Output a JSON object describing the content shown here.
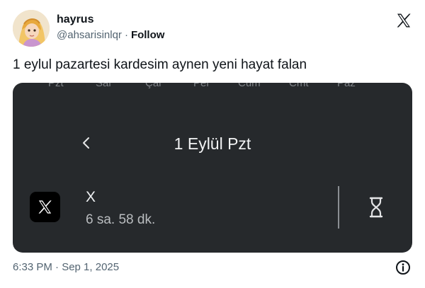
{
  "user": {
    "display_name": "hayrus",
    "handle": "@ahsarisinlqr",
    "separator": "·",
    "follow_label": "Follow"
  },
  "tweet": {
    "text": "1 eylul pazartesi kardesim aynen yeni hayat falan",
    "timestamp": "6:33 PM · Sep 1, 2025"
  },
  "media": {
    "weekdays": [
      "Pzt",
      "Sal",
      "Çar",
      "Per",
      "Cum",
      "Cmt",
      "Paz"
    ],
    "date_title": "1 Eylül Pzt",
    "app_name": "X",
    "usage_time": "6 sa. 58 dk."
  },
  "icons": {
    "brand": "x-logo-icon",
    "back": "chevron-left-icon",
    "timer": "hourglass-icon",
    "info": "info-icon"
  },
  "colors": {
    "card_background": "#26292c",
    "text_primary": "#0f1419",
    "text_secondary": "#536471"
  }
}
